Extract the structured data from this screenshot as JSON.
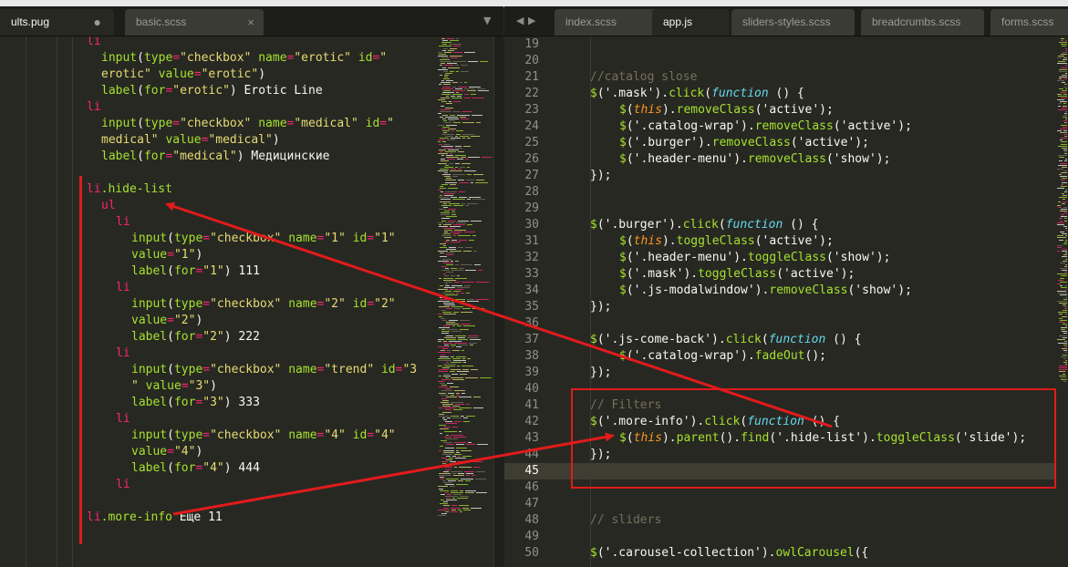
{
  "tabs_left": [
    {
      "label": "ults.pug",
      "modified": true,
      "active": true
    },
    {
      "label": "basic.scss",
      "modified": false,
      "active": false
    }
  ],
  "tabs_right": [
    {
      "label": "index.scss",
      "active": false
    },
    {
      "label": "app.js",
      "active": true
    },
    {
      "label": "sliders-styles.scss",
      "active": false
    },
    {
      "label": "breadcrumbs.scss",
      "active": false
    },
    {
      "label": "forms.scss",
      "active": false
    }
  ],
  "glyphs": {
    "close": "×",
    "modified": "●",
    "dropdown": "▼",
    "nav_left": "◀",
    "nav_right": "▶"
  },
  "left_editor": {
    "language": "pug",
    "lines": [
      [
        [
          "li",
          "t-pink"
        ]
      ],
      [
        [
          "input",
          "t-green"
        ],
        [
          "(",
          "t-white"
        ],
        [
          "type",
          "t-green"
        ],
        [
          "=",
          "t-pink"
        ],
        [
          "\"checkbox\"",
          "t-yellow"
        ],
        [
          " ",
          "t-white"
        ],
        [
          "name",
          "t-green"
        ],
        [
          "=",
          "t-pink"
        ],
        [
          "\"erotic\"",
          "t-yellow"
        ],
        [
          " ",
          "t-white"
        ],
        [
          "id",
          "t-green"
        ],
        [
          "=",
          "t-pink"
        ],
        [
          "\"",
          "t-yellow"
        ]
      ],
      [
        [
          "erotic\"",
          "t-yellow"
        ],
        [
          " ",
          "t-white"
        ],
        [
          "value",
          "t-green"
        ],
        [
          "=",
          "t-pink"
        ],
        [
          "\"erotic\"",
          "t-yellow"
        ],
        [
          ")",
          "t-white"
        ]
      ],
      [
        [
          "label",
          "t-green"
        ],
        [
          "(",
          "t-white"
        ],
        [
          "for",
          "t-green"
        ],
        [
          "=",
          "t-pink"
        ],
        [
          "\"erotic\"",
          "t-yellow"
        ],
        [
          ") Erotic Line",
          "t-white"
        ]
      ],
      [
        [
          "li",
          "t-pink"
        ]
      ],
      [
        [
          "input",
          "t-green"
        ],
        [
          "(",
          "t-white"
        ],
        [
          "type",
          "t-green"
        ],
        [
          "=",
          "t-pink"
        ],
        [
          "\"checkbox\"",
          "t-yellow"
        ],
        [
          " ",
          "t-white"
        ],
        [
          "name",
          "t-green"
        ],
        [
          "=",
          "t-pink"
        ],
        [
          "\"medical\"",
          "t-yellow"
        ],
        [
          " ",
          "t-white"
        ],
        [
          "id",
          "t-green"
        ],
        [
          "=",
          "t-pink"
        ],
        [
          "\"",
          "t-yellow"
        ]
      ],
      [
        [
          "medical\"",
          "t-yellow"
        ],
        [
          " ",
          "t-white"
        ],
        [
          "value",
          "t-green"
        ],
        [
          "=",
          "t-pink"
        ],
        [
          "\"medical\"",
          "t-yellow"
        ],
        [
          ")",
          "t-white"
        ]
      ],
      [
        [
          "label",
          "t-green"
        ],
        [
          "(",
          "t-white"
        ],
        [
          "for",
          "t-green"
        ],
        [
          "=",
          "t-pink"
        ],
        [
          "\"medical\"",
          "t-yellow"
        ],
        [
          ") Медицинские",
          "t-white"
        ]
      ],
      [],
      [
        [
          "li",
          "t-pink"
        ],
        [
          ".hide-list",
          "t-green"
        ]
      ],
      [
        [
          "ul",
          "t-pink"
        ]
      ],
      [
        [
          "li",
          "t-pink"
        ]
      ],
      [
        [
          "input",
          "t-green"
        ],
        [
          "(",
          "t-white"
        ],
        [
          "type",
          "t-green"
        ],
        [
          "=",
          "t-pink"
        ],
        [
          "\"checkbox\"",
          "t-yellow"
        ],
        [
          " ",
          "t-white"
        ],
        [
          "name",
          "t-green"
        ],
        [
          "=",
          "t-pink"
        ],
        [
          "\"1\"",
          "t-yellow"
        ],
        [
          " ",
          "t-white"
        ],
        [
          "id",
          "t-green"
        ],
        [
          "=",
          "t-pink"
        ],
        [
          "\"1\"",
          "t-yellow"
        ]
      ],
      [
        [
          "value",
          "t-green"
        ],
        [
          "=",
          "t-pink"
        ],
        [
          "\"1\"",
          "t-yellow"
        ],
        [
          ")",
          "t-white"
        ]
      ],
      [
        [
          "label",
          "t-green"
        ],
        [
          "(",
          "t-white"
        ],
        [
          "for",
          "t-green"
        ],
        [
          "=",
          "t-pink"
        ],
        [
          "\"1\"",
          "t-yellow"
        ],
        [
          ") 111",
          "t-white"
        ]
      ],
      [
        [
          "li",
          "t-pink"
        ]
      ],
      [
        [
          "input",
          "t-green"
        ],
        [
          "(",
          "t-white"
        ],
        [
          "type",
          "t-green"
        ],
        [
          "=",
          "t-pink"
        ],
        [
          "\"checkbox\"",
          "t-yellow"
        ],
        [
          " ",
          "t-white"
        ],
        [
          "name",
          "t-green"
        ],
        [
          "=",
          "t-pink"
        ],
        [
          "\"2\"",
          "t-yellow"
        ],
        [
          " ",
          "t-white"
        ],
        [
          "id",
          "t-green"
        ],
        [
          "=",
          "t-pink"
        ],
        [
          "\"2\"",
          "t-yellow"
        ]
      ],
      [
        [
          "value",
          "t-green"
        ],
        [
          "=",
          "t-pink"
        ],
        [
          "\"2\"",
          "t-yellow"
        ],
        [
          ")",
          "t-white"
        ]
      ],
      [
        [
          "label",
          "t-green"
        ],
        [
          "(",
          "t-white"
        ],
        [
          "for",
          "t-green"
        ],
        [
          "=",
          "t-pink"
        ],
        [
          "\"2\"",
          "t-yellow"
        ],
        [
          ") 222",
          "t-white"
        ]
      ],
      [
        [
          "li",
          "t-pink"
        ]
      ],
      [
        [
          "input",
          "t-green"
        ],
        [
          "(",
          "t-white"
        ],
        [
          "type",
          "t-green"
        ],
        [
          "=",
          "t-pink"
        ],
        [
          "\"checkbox\"",
          "t-yellow"
        ],
        [
          " ",
          "t-white"
        ],
        [
          "name",
          "t-green"
        ],
        [
          "=",
          "t-pink"
        ],
        [
          "\"trend\"",
          "t-yellow"
        ],
        [
          " ",
          "t-white"
        ],
        [
          "id",
          "t-green"
        ],
        [
          "=",
          "t-pink"
        ],
        [
          "\"3",
          "t-yellow"
        ]
      ],
      [
        [
          "\"",
          "t-yellow"
        ],
        [
          " ",
          "t-white"
        ],
        [
          "value",
          "t-green"
        ],
        [
          "=",
          "t-pink"
        ],
        [
          "\"3\"",
          "t-yellow"
        ],
        [
          ")",
          "t-white"
        ]
      ],
      [
        [
          "label",
          "t-green"
        ],
        [
          "(",
          "t-white"
        ],
        [
          "for",
          "t-green"
        ],
        [
          "=",
          "t-pink"
        ],
        [
          "\"3\"",
          "t-yellow"
        ],
        [
          ") 333",
          "t-white"
        ]
      ],
      [
        [
          "li",
          "t-pink"
        ]
      ],
      [
        [
          "input",
          "t-green"
        ],
        [
          "(",
          "t-white"
        ],
        [
          "type",
          "t-green"
        ],
        [
          "=",
          "t-pink"
        ],
        [
          "\"checkbox\"",
          "t-yellow"
        ],
        [
          " ",
          "t-white"
        ],
        [
          "name",
          "t-green"
        ],
        [
          "=",
          "t-pink"
        ],
        [
          "\"4\"",
          "t-yellow"
        ],
        [
          " ",
          "t-white"
        ],
        [
          "id",
          "t-green"
        ],
        [
          "=",
          "t-pink"
        ],
        [
          "\"4\"",
          "t-yellow"
        ]
      ],
      [
        [
          "value",
          "t-green"
        ],
        [
          "=",
          "t-pink"
        ],
        [
          "\"4\"",
          "t-yellow"
        ],
        [
          ")",
          "t-white"
        ]
      ],
      [
        [
          "label",
          "t-green"
        ],
        [
          "(",
          "t-white"
        ],
        [
          "for",
          "t-green"
        ],
        [
          "=",
          "t-pink"
        ],
        [
          "\"4\"",
          "t-yellow"
        ],
        [
          ") 444",
          "t-white"
        ]
      ],
      [
        [
          "li",
          "t-pink"
        ]
      ],
      [],
      [
        [
          "li",
          "t-pink"
        ],
        [
          ".more-info",
          "t-green"
        ],
        [
          " Еще 11",
          "t-white"
        ]
      ]
    ]
  },
  "right_editor": {
    "language": "javascript",
    "line_numbers": [
      "19",
      "20",
      "21",
      "22",
      "23",
      "24",
      "25",
      "26",
      "27",
      "28",
      "29",
      "30",
      "31",
      "32",
      "33",
      "34",
      "35",
      "36",
      "37",
      "38",
      "39",
      "40",
      "41",
      "42",
      "43",
      "44",
      "45",
      "46",
      "47",
      "48",
      "49",
      "50"
    ],
    "current_line": "45",
    "lines": [
      [],
      [],
      [
        [
          "//catalog slose",
          "t-grey"
        ]
      ],
      [
        [
          "$",
          "t-green"
        ],
        [
          "('.mask').",
          "t-white"
        ],
        [
          "click",
          "t-green"
        ],
        [
          "(",
          "t-white"
        ],
        [
          "function",
          "t-cyan"
        ],
        [
          " () {",
          "t-white"
        ]
      ],
      [
        [
          "$",
          "t-green"
        ],
        [
          "(",
          "t-white"
        ],
        [
          "this",
          "t-orange"
        ],
        [
          ").",
          "t-white"
        ],
        [
          "removeClass",
          "t-green"
        ],
        [
          "('active');",
          "t-white"
        ]
      ],
      [
        [
          "$",
          "t-green"
        ],
        [
          "('.catalog-wrap').",
          "t-white"
        ],
        [
          "removeClass",
          "t-green"
        ],
        [
          "('active');",
          "t-white"
        ]
      ],
      [
        [
          "$",
          "t-green"
        ],
        [
          "('.burger').",
          "t-white"
        ],
        [
          "removeClass",
          "t-green"
        ],
        [
          "('active');",
          "t-white"
        ]
      ],
      [
        [
          "$",
          "t-green"
        ],
        [
          "('.header-menu').",
          "t-white"
        ],
        [
          "removeClass",
          "t-green"
        ],
        [
          "('show');",
          "t-white"
        ]
      ],
      [
        [
          "});",
          "t-white"
        ]
      ],
      [],
      [],
      [
        [
          "$",
          "t-green"
        ],
        [
          "('.burger').",
          "t-white"
        ],
        [
          "click",
          "t-green"
        ],
        [
          "(",
          "t-white"
        ],
        [
          "function",
          "t-cyan"
        ],
        [
          " () {",
          "t-white"
        ]
      ],
      [
        [
          "$",
          "t-green"
        ],
        [
          "(",
          "t-white"
        ],
        [
          "this",
          "t-orange"
        ],
        [
          ").",
          "t-white"
        ],
        [
          "toggleClass",
          "t-green"
        ],
        [
          "('active');",
          "t-white"
        ]
      ],
      [
        [
          "$",
          "t-green"
        ],
        [
          "('.header-menu').",
          "t-white"
        ],
        [
          "toggleClass",
          "t-green"
        ],
        [
          "('show');",
          "t-white"
        ]
      ],
      [
        [
          "$",
          "t-green"
        ],
        [
          "('.mask').",
          "t-white"
        ],
        [
          "toggleClass",
          "t-green"
        ],
        [
          "('active');",
          "t-white"
        ]
      ],
      [
        [
          "$",
          "t-green"
        ],
        [
          "('.js-modalwindow').",
          "t-white"
        ],
        [
          "removeClass",
          "t-green"
        ],
        [
          "('show');",
          "t-white"
        ]
      ],
      [
        [
          "});",
          "t-white"
        ]
      ],
      [],
      [
        [
          "$",
          "t-green"
        ],
        [
          "('.js-come-back').",
          "t-white"
        ],
        [
          "click",
          "t-green"
        ],
        [
          "(",
          "t-white"
        ],
        [
          "function",
          "t-cyan"
        ],
        [
          " () {",
          "t-white"
        ]
      ],
      [
        [
          "$",
          "t-green"
        ],
        [
          "('.catalog-wrap').",
          "t-white"
        ],
        [
          "fadeOut",
          "t-green"
        ],
        [
          "();",
          "t-white"
        ]
      ],
      [
        [
          "});",
          "t-white"
        ]
      ],
      [],
      [
        [
          "// Filters",
          "t-grey"
        ]
      ],
      [
        [
          "$",
          "t-green"
        ],
        [
          "('.more-info').",
          "t-white"
        ],
        [
          "click",
          "t-green"
        ],
        [
          "(",
          "t-white"
        ],
        [
          "function",
          "t-cyan"
        ],
        [
          " () {",
          "t-white"
        ]
      ],
      [
        [
          "$",
          "t-green"
        ],
        [
          "(",
          "t-white"
        ],
        [
          "this",
          "t-orange"
        ],
        [
          ").",
          "t-white"
        ],
        [
          "parent",
          "t-green"
        ],
        [
          "().",
          "t-white"
        ],
        [
          "find",
          "t-green"
        ],
        [
          "('.hide-list').",
          "t-white"
        ],
        [
          "toggleClass",
          "t-green"
        ],
        [
          "('slide');",
          "t-white"
        ]
      ],
      [
        [
          "});",
          "t-white"
        ]
      ],
      [],
      [],
      [],
      [
        [
          "// sliders",
          "t-grey"
        ]
      ],
      [],
      [
        [
          "$",
          "t-green"
        ],
        [
          "('.carousel-collection').",
          "t-white"
        ],
        [
          "owlCarousel",
          "t-green"
        ],
        [
          "({",
          "t-white"
        ]
      ]
    ]
  },
  "annotation_color": "#e11b1b"
}
